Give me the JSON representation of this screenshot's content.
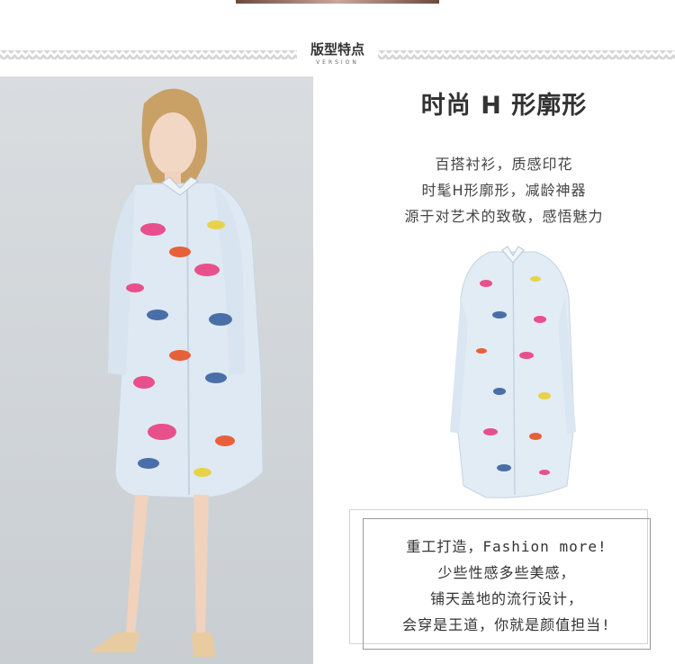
{
  "section": {
    "title": "版型特点",
    "subtitle": "VERSION"
  },
  "headline": "时尚 H 形廓形",
  "features": [
    "百搭衬衫，质感印花",
    "时髦H形廓形，减龄神器",
    "源于对艺术的致敬，感悟魅力"
  ],
  "promo": [
    "重工打造，Fashion more!",
    "少些性感多些美感，",
    "铺天盖地的流行设计，",
    "会穿是王道，你就是颜值担当!"
  ],
  "colors": {
    "dress_base": "#dfe9f3",
    "print_pink": "#e8508c",
    "print_blue": "#4a6fa8",
    "print_orange": "#e8603a",
    "print_yellow": "#e8d24a",
    "shoe": "#e8cba0"
  }
}
